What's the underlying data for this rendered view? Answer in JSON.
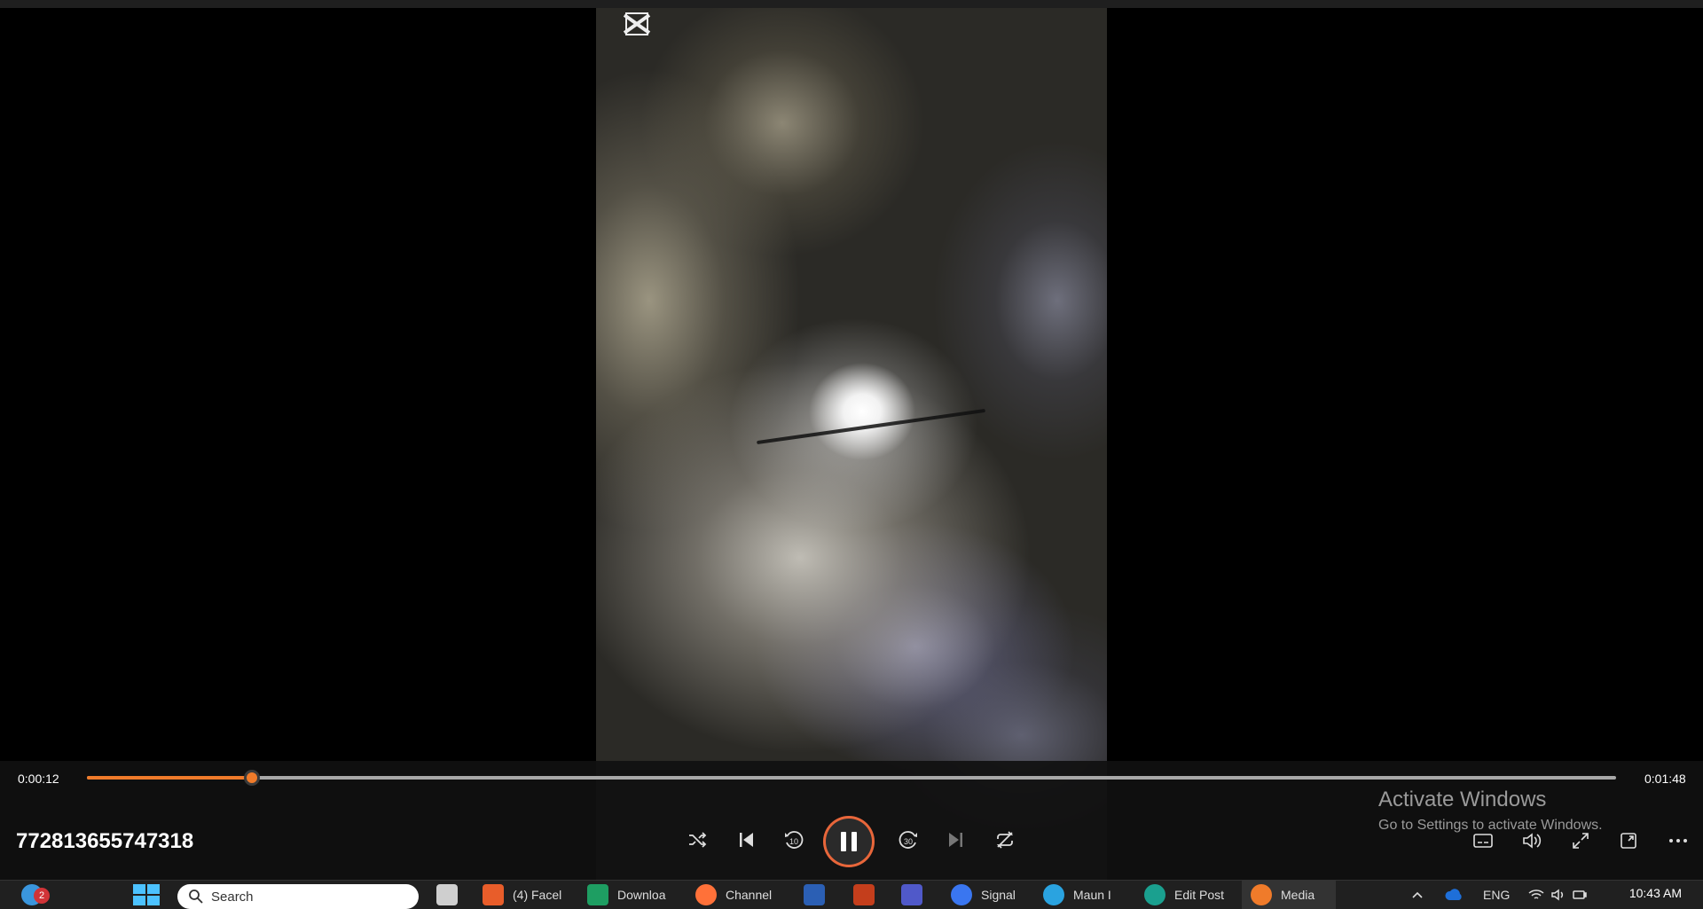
{
  "player": {
    "elapsed": "0:00:12",
    "duration": "0:01:48",
    "progress": 0.108,
    "title": "772813655747318",
    "accent_color": "#f07b2a",
    "controls": [
      "shuffle-icon",
      "previous-icon",
      "rewind-10-icon",
      "pause-icon",
      "forward-30-icon",
      "next-icon",
      "repeat-icon"
    ],
    "rewind_seconds": "10",
    "forward_seconds": "30",
    "right_controls": [
      "subtitles-icon",
      "volume-icon",
      "fullscreen-icon",
      "miniplayer-icon",
      "more-icon"
    ]
  },
  "watermark": {
    "line1": "Activate Windows",
    "line2": "Go to Settings to activate Windows."
  },
  "taskbar": {
    "search_placeholder": "Search",
    "notification_count": "2",
    "apps": [
      {
        "label": "(4) Facel",
        "color": "#e85d2a",
        "icon": "brave-icon"
      },
      {
        "label": "Downloa",
        "color": "#1e9e62",
        "icon": "downloads-icon"
      },
      {
        "label": "Channel",
        "color": "#ff7139",
        "icon": "firefox-icon"
      },
      {
        "label": "",
        "color": "#2b5fb4",
        "icon": "word-icon"
      },
      {
        "label": "",
        "color": "#c43e1c",
        "icon": "powerpoint-icon"
      },
      {
        "label": "",
        "color": "#5059c9",
        "icon": "teams-icon"
      },
      {
        "label": "Signal",
        "color": "#3a76f0",
        "icon": "signal-icon"
      },
      {
        "label": "Maun I",
        "color": "#2aa3e0",
        "icon": "telegram-icon"
      },
      {
        "label": "Edit Post",
        "color": "#1aa08f",
        "icon": "edge-icon"
      },
      {
        "label": "Media",
        "color": "#f07b2a",
        "icon": "media-player-icon"
      }
    ],
    "lang": "ENG",
    "time": "10:43 AM"
  }
}
